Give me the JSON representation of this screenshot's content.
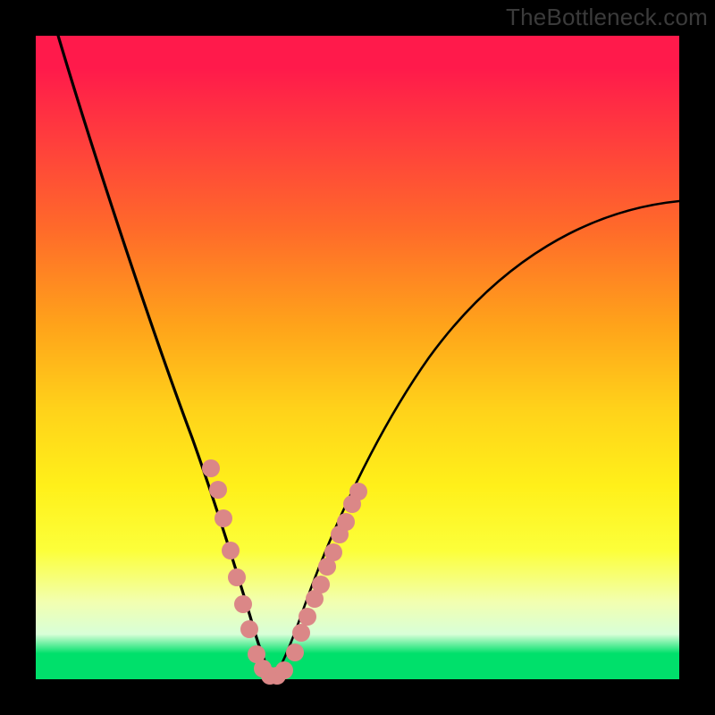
{
  "watermark": "TheBottleneck.com",
  "gradient_colors": {
    "top": "#ff1a4b",
    "mid_upper": "#ffa31a",
    "mid_lower": "#fff01a",
    "bottom": "#00e06b"
  },
  "curve_color": "#000000",
  "marker_color": "#d98080",
  "chart_data": {
    "type": "line",
    "title": "",
    "xlabel": "",
    "ylabel": "",
    "ylim": [
      0,
      100
    ],
    "xlim": [
      0,
      100
    ],
    "series": [
      {
        "name": "curve-left",
        "x": [
          8,
          12,
          16,
          20,
          24,
          26,
          28,
          30,
          31,
          32,
          33,
          34,
          35,
          36,
          37
        ],
        "y": [
          100,
          82,
          66,
          52,
          38,
          32,
          25,
          18,
          14,
          10,
          7,
          4,
          2,
          1,
          0
        ]
      },
      {
        "name": "curve-right",
        "x": [
          37,
          38,
          39,
          40,
          42,
          44,
          46,
          50,
          55,
          60,
          68,
          76,
          85,
          92,
          100
        ],
        "y": [
          0,
          1,
          2,
          4,
          8,
          12,
          16,
          23,
          31,
          38,
          48,
          56,
          64,
          69,
          74
        ]
      }
    ],
    "markers": [
      {
        "x": 27,
        "y": 33
      },
      {
        "x": 28,
        "y": 29
      },
      {
        "x": 29,
        "y": 24
      },
      {
        "x": 30,
        "y": 19
      },
      {
        "x": 31,
        "y": 15
      },
      {
        "x": 32,
        "y": 11
      },
      {
        "x": 33,
        "y": 7
      },
      {
        "x": 34,
        "y": 3
      },
      {
        "x": 35,
        "y": 1
      },
      {
        "x": 36,
        "y": 0
      },
      {
        "x": 37,
        "y": 0
      },
      {
        "x": 38,
        "y": 1
      },
      {
        "x": 40,
        "y": 4
      },
      {
        "x": 41,
        "y": 7
      },
      {
        "x": 42,
        "y": 9
      },
      {
        "x": 43,
        "y": 12
      },
      {
        "x": 44,
        "y": 14
      },
      {
        "x": 45,
        "y": 17
      },
      {
        "x": 46,
        "y": 19
      },
      {
        "x": 47,
        "y": 22
      },
      {
        "x": 48,
        "y": 24
      },
      {
        "x": 49,
        "y": 27
      },
      {
        "x": 50,
        "y": 29
      }
    ]
  }
}
